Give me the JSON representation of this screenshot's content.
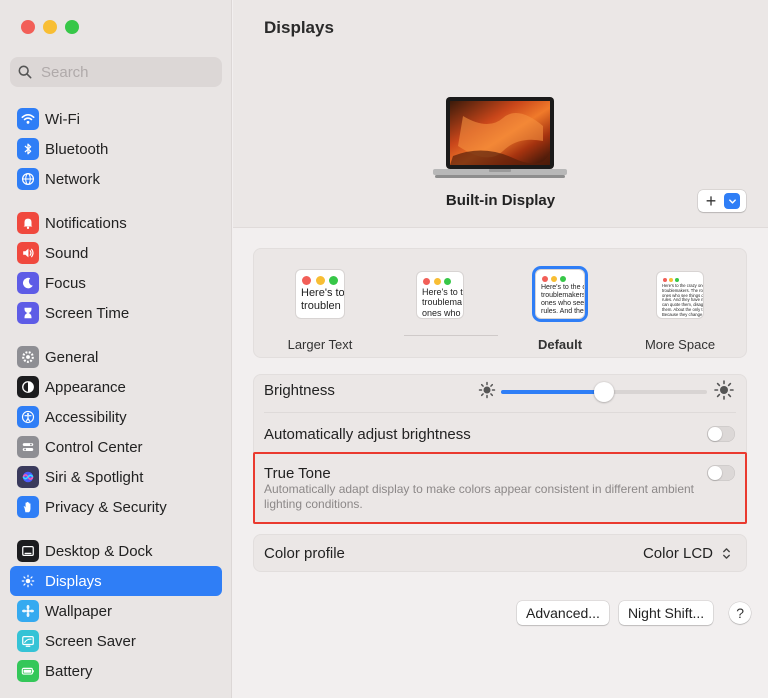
{
  "sidebar": {
    "search": {
      "placeholder": "Search"
    },
    "groups": [
      [
        {
          "label": "Wi-Fi",
          "icon": "wifi-icon",
          "color": "#2f7ef6"
        },
        {
          "label": "Bluetooth",
          "icon": "bluetooth-icon",
          "color": "#2f7ef6"
        },
        {
          "label": "Network",
          "icon": "globe-icon",
          "color": "#2f7ef6"
        }
      ],
      [
        {
          "label": "Notifications",
          "icon": "bell-icon",
          "color": "#f0493e"
        },
        {
          "label": "Sound",
          "icon": "speaker-icon",
          "color": "#f0493e"
        },
        {
          "label": "Focus",
          "icon": "moon-icon",
          "color": "#5e5ce6"
        },
        {
          "label": "Screen Time",
          "icon": "hourglass-icon",
          "color": "#5e5ce6"
        }
      ],
      [
        {
          "label": "General",
          "icon": "gear-icon",
          "color": "#8e8e93"
        },
        {
          "label": "Appearance",
          "icon": "appearance-icon",
          "color": "#1c1c1e"
        },
        {
          "label": "Accessibility",
          "icon": "accessibility-icon",
          "color": "#2f7ef6"
        },
        {
          "label": "Control Center",
          "icon": "control-center-icon",
          "color": "#8e8e93"
        },
        {
          "label": "Siri & Spotlight",
          "icon": "siri-icon",
          "color": "#3a3a5c"
        },
        {
          "label": "Privacy & Security",
          "icon": "hand-icon",
          "color": "#2f7ef6"
        }
      ],
      [
        {
          "label": "Desktop & Dock",
          "icon": "dock-icon",
          "color": "#1c1c1e"
        },
        {
          "label": "Displays",
          "icon": "sun-icon",
          "color": "#2f7ef6",
          "active": true
        },
        {
          "label": "Wallpaper",
          "icon": "wallpaper-icon",
          "color": "#35aaf0"
        },
        {
          "label": "Screen Saver",
          "icon": "screen-saver-icon",
          "color": "#35c3d6"
        },
        {
          "label": "Battery",
          "icon": "battery-icon",
          "color": "#34c759"
        }
      ]
    ]
  },
  "main": {
    "title": "Displays",
    "display_name": "Built-in Display",
    "add_label": "+",
    "resolutions": [
      {
        "label": "Larger Text",
        "preview": "Here's to\ntroublen"
      },
      {
        "label": "",
        "preview": "Here's to t\ntroublema\nones who"
      },
      {
        "label": "Default",
        "preview": "Here's to the c\ntroublemakers\nones who see t\nrules. And they",
        "selected": true
      },
      {
        "label": "More Space",
        "preview": "Here's to the crazy one\ntroublemakers. The ro\nones who see things d\nrules. And they have n\ncan quote them, disag\nthem. About the only t\nBecause they change t"
      }
    ],
    "brightness": {
      "label": "Brightness",
      "value": 0.5
    },
    "auto_brightness": {
      "label": "Automatically adjust brightness",
      "on": false
    },
    "true_tone": {
      "label": "True Tone",
      "description": "Automatically adapt display to make colors appear consistent in different ambient lighting conditions.",
      "on": false
    },
    "color_profile": {
      "label": "Color profile",
      "value": "Color LCD"
    },
    "buttons": {
      "advanced": "Advanced...",
      "night_shift": "Night Shift...",
      "help": "?"
    }
  }
}
